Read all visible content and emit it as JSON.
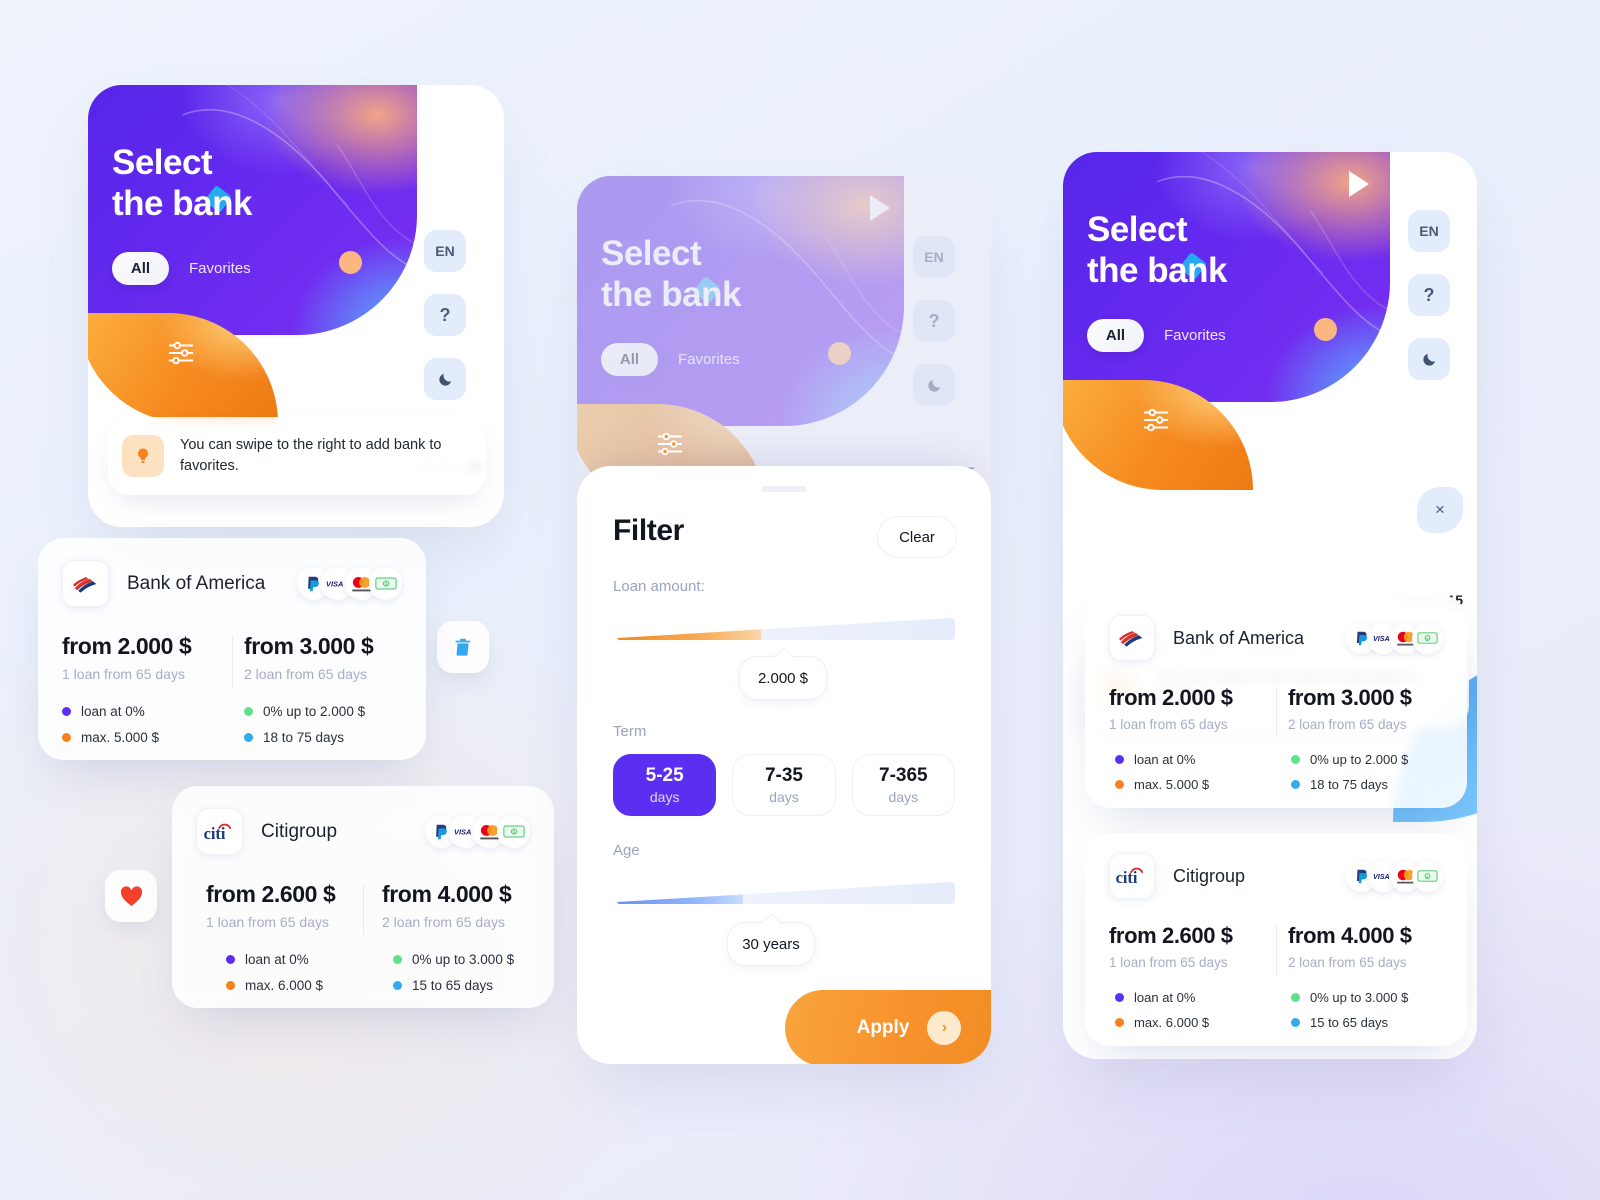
{
  "app": {
    "hero_title_line1": "Select",
    "hero_title_line2": "the bank",
    "tab_all": "All",
    "tab_favorites": "Favorites",
    "lang_button": "EN",
    "help_button": "?",
    "theme_button": "moon-icon",
    "banks_label": "Banks:",
    "banks_count": "15",
    "tip_text": "You can swipe to the right to add bank to favorites.",
    "close_label": "×",
    "accent_purple": "#5a2ff2",
    "accent_orange": "#f7922c",
    "accent_blue": "#4a9cf2"
  },
  "banks": [
    {
      "name": "Bank of America",
      "logo": "bank-of-america-logo",
      "payments": [
        "paypal-icon",
        "visa-icon",
        "mastercard-icon",
        "cash-icon"
      ],
      "left_amount": "from 2.000 $",
      "left_sub": "1 loan from 65 days",
      "right_amount": "from 3.000 $",
      "right_sub": "2 loan from 65 days",
      "features": [
        {
          "label": "loan at 0%",
          "color": "#5a2ff2"
        },
        {
          "label": "0% up to 2.000 $",
          "color": "#5fe08a"
        },
        {
          "label": "max. 5.000 $",
          "color": "#f7821b"
        },
        {
          "label": "18 to 75 days",
          "color": "#34a8f0"
        }
      ]
    },
    {
      "name": "Citigroup",
      "logo": "citigroup-logo",
      "payments": [
        "paypal-icon",
        "visa-icon",
        "mastercard-icon",
        "cash-icon"
      ],
      "left_amount": "from 2.600 $",
      "left_sub": "1 loan from 65 days",
      "right_amount": "from 4.000 $",
      "right_sub": "2 loan from 65 days",
      "features": [
        {
          "label": "loan at 0%",
          "color": "#5a2ff2"
        },
        {
          "label": "0% up to 3.000 $",
          "color": "#5fe08a"
        },
        {
          "label": "max. 6.000 $",
          "color": "#f7821b"
        },
        {
          "label": "15 to 65 days",
          "color": "#34a8f0"
        }
      ]
    }
  ],
  "swipe_actions": {
    "delete_icon": "trash-icon",
    "favorite_icon": "heart-icon"
  },
  "filter": {
    "title": "Filter",
    "clear": "Clear",
    "loan_amount_label": "Loan amount:",
    "loan_amount_value": "2.000 $",
    "loan_amount_fill_pct": 42,
    "term_label": "Term",
    "terms": [
      {
        "range": "5-25",
        "unit": "days",
        "selected": true
      },
      {
        "range": "7-35",
        "unit": "days",
        "selected": false
      },
      {
        "range": "7-365",
        "unit": "days",
        "selected": false
      }
    ],
    "age_label": "Age",
    "age_value": "30 years",
    "age_fill_pct": 38,
    "apply": "Apply",
    "apply_arrow": "chevron-right-icon"
  }
}
